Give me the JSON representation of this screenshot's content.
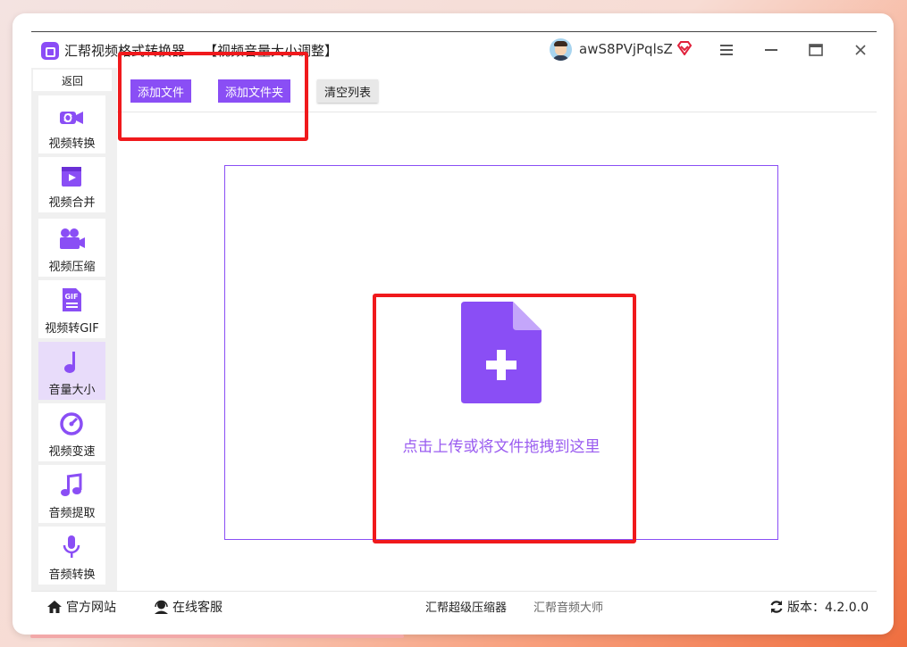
{
  "window": {
    "app_title": "汇帮视频格式转换器",
    "page_title": "【视频音量大小调整】",
    "username": "awS8PVjPqlsZ",
    "vip_icon": "vip-diamond-icon",
    "controls": [
      "menu-icon",
      "minimize-icon",
      "maximize-icon",
      "close-icon"
    ]
  },
  "sidebar": {
    "back_label": "返回",
    "items": [
      {
        "label": "视频转换",
        "icon": "video-convert-icon"
      },
      {
        "label": "视频合并",
        "icon": "video-merge-icon"
      },
      {
        "label": "视频压缩",
        "icon": "video-compress-icon"
      },
      {
        "label": "视频转GIF",
        "icon": "gif-icon"
      },
      {
        "label": "音量大小",
        "icon": "music-note-icon",
        "active": true
      },
      {
        "label": "视频变速",
        "icon": "speedometer-icon"
      },
      {
        "label": "音频提取",
        "icon": "audio-extract-icon"
      },
      {
        "label": "音频转换",
        "icon": "microphone-icon"
      }
    ]
  },
  "toolbar": {
    "add_file": "添加文件",
    "add_folder": "添加文件夹",
    "clear_list": "清空列表"
  },
  "dropzone": {
    "text": "点击上传或将文件拖拽到这里",
    "icon": "add-file-icon"
  },
  "footer": {
    "official_site": "官方网站",
    "online_service": "在线客服",
    "link1": "汇帮超级压缩器",
    "link2": "汇帮音频大师",
    "version_label": "版本：4.2.0.0"
  },
  "colors": {
    "accent": "#8a4ef5",
    "highlight": "#f0191c"
  }
}
